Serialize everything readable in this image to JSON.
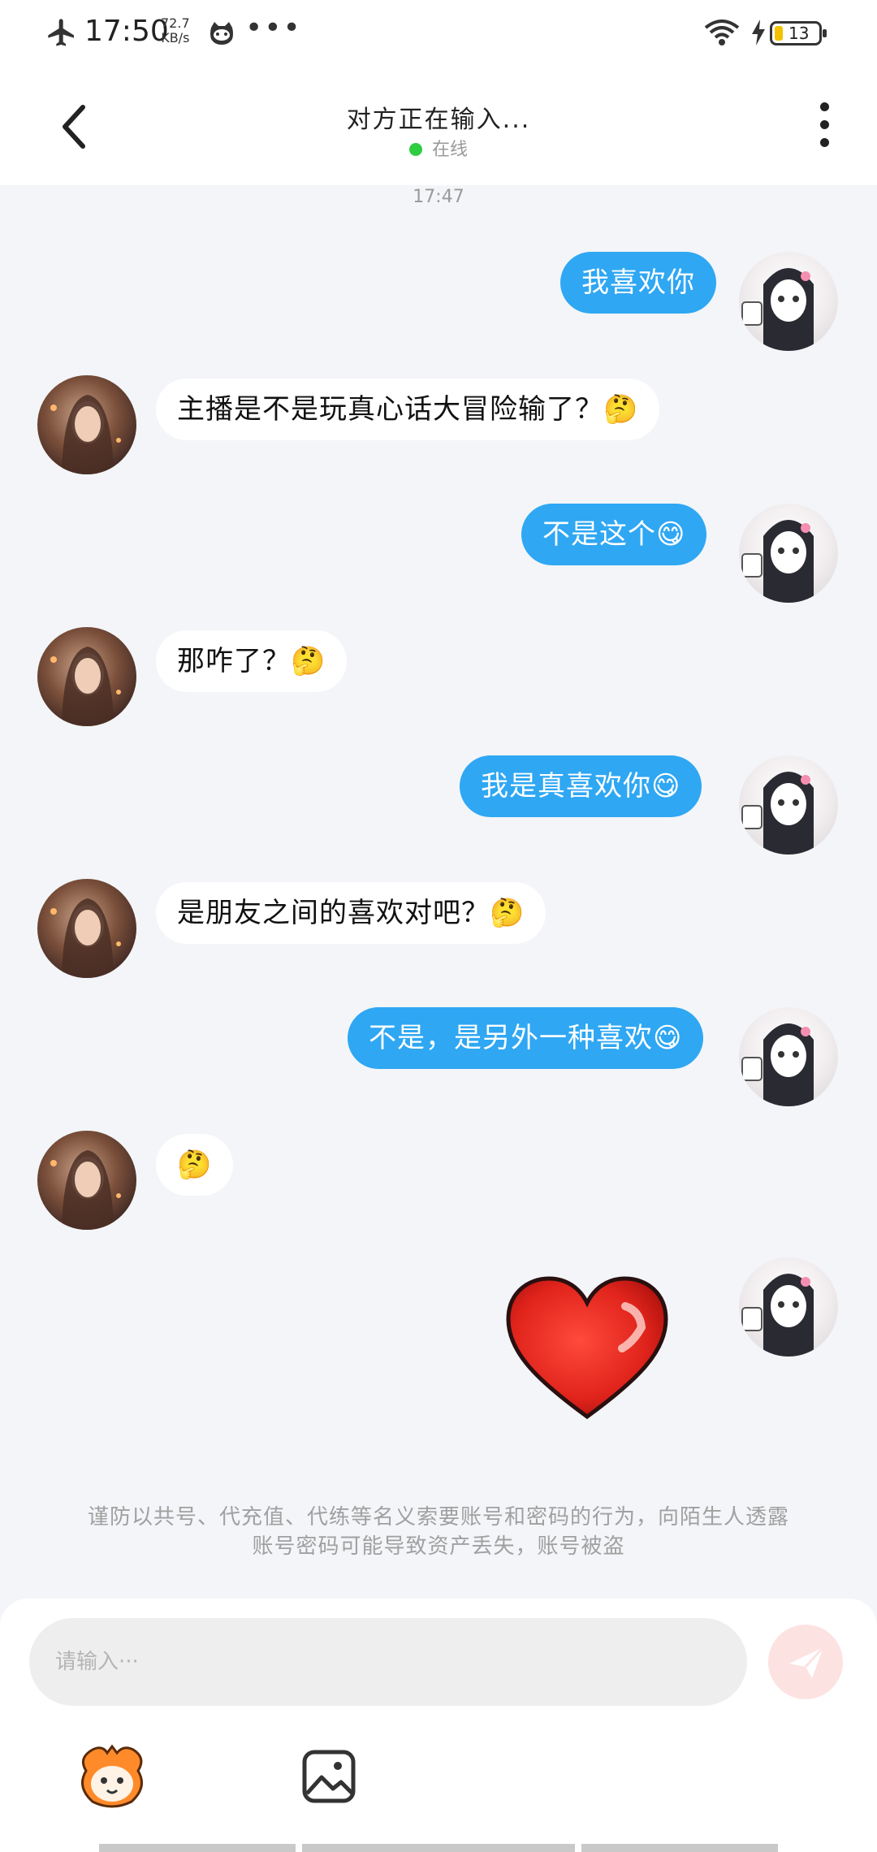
{
  "status_bar": {
    "time": "17:50",
    "net_speed_value": "72.7",
    "net_speed_unit": "KB/s",
    "battery": "13",
    "icons": [
      "airplane-icon",
      "cat-icon",
      "more-dots-icon",
      "wifi-icon",
      "charging-icon",
      "battery-icon"
    ]
  },
  "header": {
    "title": "对方正在输入...",
    "status": "在线"
  },
  "timestamp": "17:47",
  "messages": [
    {
      "side": "me",
      "text": "我喜欢你"
    },
    {
      "side": "them",
      "text": "主播是不是玩真心话大冒险输了？🤔"
    },
    {
      "side": "me",
      "text": "不是这个😋"
    },
    {
      "side": "them",
      "text": "那咋了？🤔"
    },
    {
      "side": "me",
      "text": "我是真喜欢你😋"
    },
    {
      "side": "them",
      "text": "是朋友之间的喜欢对吧？🤔"
    },
    {
      "side": "me",
      "text": "不是，是另外一种喜欢😋"
    },
    {
      "side": "them",
      "text": "🤔"
    },
    {
      "side": "me",
      "type": "sticker",
      "sticker": "red-heart-sticker"
    }
  ],
  "notice": {
    "line1": "谨防以共号、代充值、代练等名义索要账号和密码的行为，向陌生人透露",
    "line2": "账号密码可能导致资产丢失，账号被盗"
  },
  "composer": {
    "placeholder": "请输入···",
    "send_color": "#fde2e2"
  },
  "colors": {
    "my_bubble": "#2fa7f3",
    "their_bubble": "#ffffff",
    "background": "#f3f5f8",
    "online_dot": "#2ecc40"
  }
}
